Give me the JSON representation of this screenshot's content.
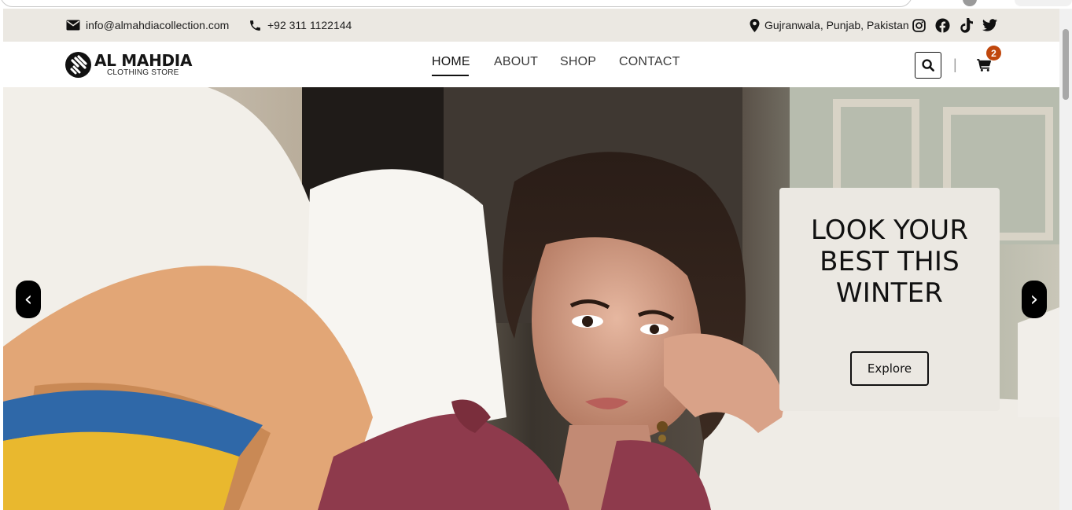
{
  "topbar": {
    "email": "info@almahdiacollection.com",
    "phone": "+92 311 1122144",
    "location": "Gujranwala, Punjab, Pakistan",
    "social_icons": [
      "instagram-icon",
      "facebook-icon",
      "tiktok-icon",
      "twitter-icon"
    ]
  },
  "brand": {
    "name": "AL MAHDIA",
    "tagline": "CLOTHING STORE"
  },
  "nav": {
    "items": [
      {
        "label": "HOME",
        "active": true
      },
      {
        "label": "ABOUT",
        "active": false
      },
      {
        "label": "SHOP",
        "active": false
      },
      {
        "label": "CONTACT",
        "active": false
      }
    ],
    "divider": "|",
    "cart_count": "2"
  },
  "hero": {
    "title": "LOOK YOUR BEST THIS WINTER",
    "cta_label": "Explore",
    "prev_arrow": "‹",
    "next_arrow": "›"
  },
  "colors": {
    "topbar_bg": "#ebe8e2",
    "accent_badge": "#c0470c",
    "text": "#111111"
  }
}
